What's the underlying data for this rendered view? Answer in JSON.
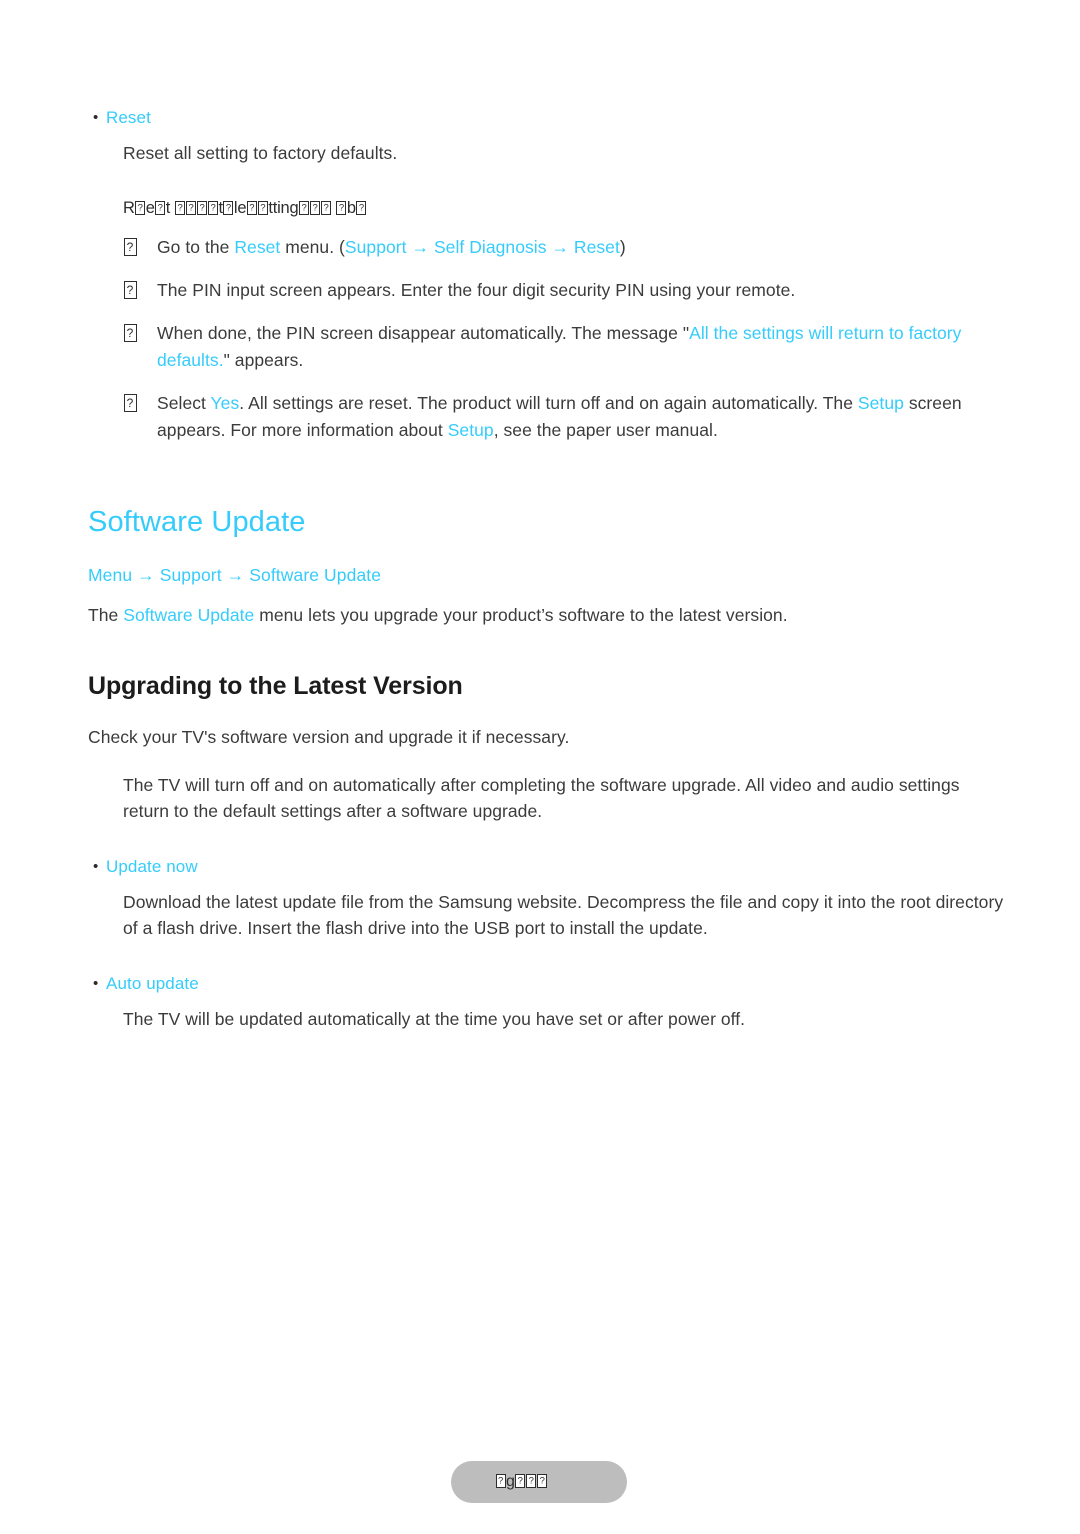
{
  "document": {
    "background_color": "#ffffff",
    "accent_color": "#35ccfb",
    "body_text_color": "#3b3b3b",
    "heading_color": "#1c1c1c"
  },
  "reset_section": {
    "bullet_label": "Reset",
    "description": "Reset all setting to factory defaults.",
    "garbled_note": {
      "note": "line rendered with missing glyphs (tofu boxes)",
      "segments": [
        {
          "type": "text",
          "value": "R"
        },
        {
          "type": "tofu"
        },
        {
          "type": "text",
          "value": "e"
        },
        {
          "type": "tofu"
        },
        {
          "type": "text",
          "value": "t "
        },
        {
          "type": "tofu"
        },
        {
          "type": "tofu"
        },
        {
          "type": "tofu"
        },
        {
          "type": "tofu"
        },
        {
          "type": "text",
          "value": "t"
        },
        {
          "type": "tofu"
        },
        {
          "type": "text",
          "value": "le"
        },
        {
          "type": "tofu"
        },
        {
          "type": "tofu"
        },
        {
          "type": "text",
          "value": "tting"
        },
        {
          "type": "tofu"
        },
        {
          "type": "tofu"
        },
        {
          "type": "tofu"
        },
        {
          "type": "text",
          "value": " "
        },
        {
          "type": "tofu"
        },
        {
          "type": "text",
          "value": "b"
        },
        {
          "type": "tofu"
        }
      ]
    },
    "steps": [
      {
        "marker": "tofu",
        "segments": [
          {
            "type": "text",
            "value": "Go to the "
          },
          {
            "type": "accent",
            "value": "Reset"
          },
          {
            "type": "text",
            "value": " menu. ("
          },
          {
            "type": "accent",
            "value": "Support"
          },
          {
            "type": "accent",
            "value": " → "
          },
          {
            "type": "accent",
            "value": "Self Diagnosis"
          },
          {
            "type": "accent",
            "value": " → "
          },
          {
            "type": "accent",
            "value": "Reset"
          },
          {
            "type": "text",
            "value": ")"
          }
        ]
      },
      {
        "marker": "tofu",
        "segments": [
          {
            "type": "text",
            "value": "The PIN input screen appears. Enter the four digit security PIN using your remote."
          }
        ]
      },
      {
        "marker": "tofu",
        "segments": [
          {
            "type": "text",
            "value": "When done, the PIN screen disappear automatically. The message \""
          },
          {
            "type": "accent",
            "value": "All the settings will return to factory defaults."
          },
          {
            "type": "text",
            "value": "\" appears."
          }
        ]
      },
      {
        "marker": "tofu",
        "segments": [
          {
            "type": "text",
            "value": "Select "
          },
          {
            "type": "accent",
            "value": "Yes"
          },
          {
            "type": "text",
            "value": ". All settings are reset. The product will turn off and on again automatically. The "
          },
          {
            "type": "accent",
            "value": "Setup"
          },
          {
            "type": "text",
            "value": " screen appears. For more information about "
          },
          {
            "type": "accent",
            "value": "Setup"
          },
          {
            "type": "text",
            "value": ", see the paper user manual."
          }
        ]
      }
    ]
  },
  "software_update_section": {
    "title": "Software Update",
    "breadcrumb": {
      "items": [
        "Menu",
        "Support",
        "Software Update"
      ],
      "separator": "→",
      "full_text": "Menu → Support → Software Update"
    },
    "intro": {
      "segments": [
        {
          "type": "text",
          "value": "The "
        },
        {
          "type": "accent",
          "value": "Software Update"
        },
        {
          "type": "text",
          "value": " menu lets you upgrade your product’s software to the latest version."
        }
      ]
    }
  },
  "upgrading_section": {
    "title": "Upgrading to the Latest Version",
    "lead": "Check your TV's software version and upgrade it if necessary.",
    "note": "The TV will turn off and on automatically after completing the software upgrade. All video and audio settings return to the default settings after a software upgrade.",
    "items": [
      {
        "label": "Update now",
        "body": "Download the latest update file from the Samsung website. Decompress the file and copy it into the root directory of a flash drive. Insert the flash drive into the USB port to install the update."
      },
      {
        "label": "Auto update",
        "body": "The TV will be updated automatically at the time you have set or after power off."
      }
    ]
  },
  "footer": {
    "background_color": "#bdbdbd",
    "garbled_text": {
      "note": "page-number pill rendered with missing glyphs",
      "segments": [
        {
          "type": "tofu"
        },
        {
          "type": "text",
          "value": "g"
        },
        {
          "type": "tofu"
        },
        {
          "type": "tofu"
        },
        {
          "type": "tofu"
        }
      ]
    }
  }
}
